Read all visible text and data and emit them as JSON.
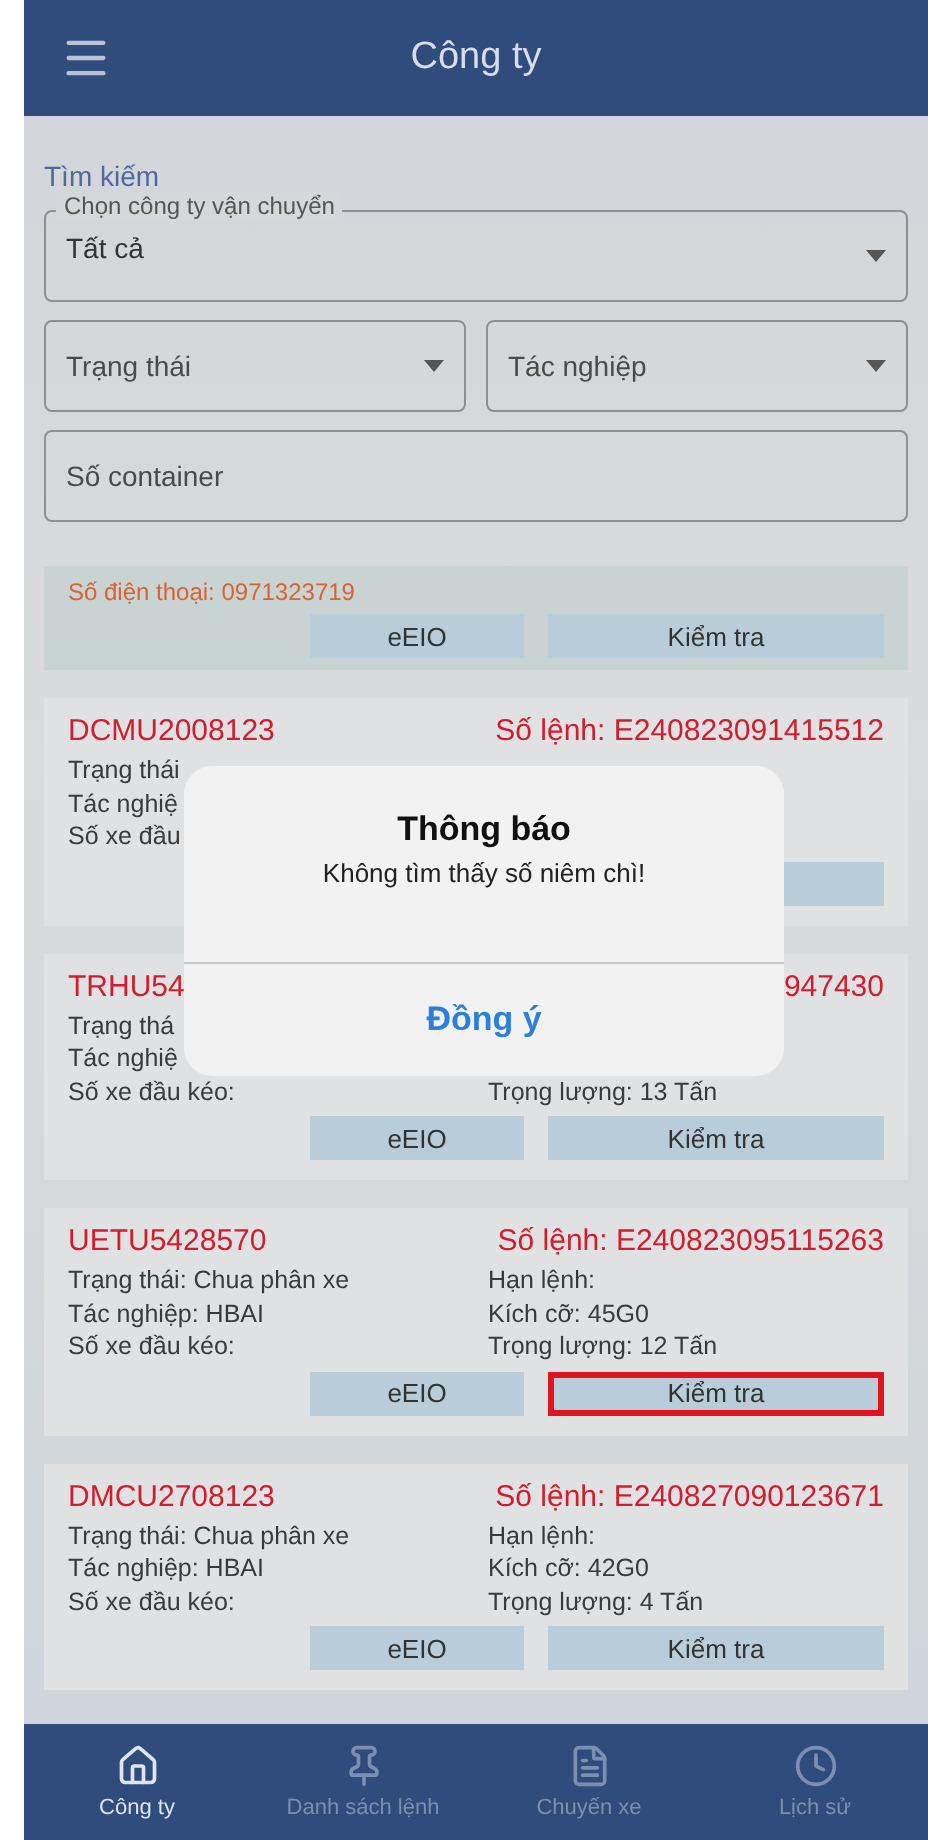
{
  "header": {
    "title": "Công ty"
  },
  "search": {
    "heading": "Tìm kiếm",
    "company_select": {
      "label": "Chọn công ty vận chuyển",
      "value": "Tất cả"
    },
    "status_select": {
      "placeholder": "Trạng thái"
    },
    "operation_select": {
      "placeholder": "Tác nghiệp"
    },
    "container_field": {
      "placeholder": "Số container"
    }
  },
  "cards": [
    {
      "kind": "phone",
      "phone": "Số điện thoại: 0971323719",
      "buttons": [
        {
          "label": "eEIO",
          "highlighted": false
        },
        {
          "label": "Kiểm tra",
          "highlighted": false
        }
      ]
    },
    {
      "kind": "order",
      "container": "DCMU2008123",
      "order_no": "Số lệnh: E240823091415512",
      "rows": [
        {
          "left": "Trạng thái"
        },
        {
          "left": "Tác nghiệ"
        },
        {
          "left": "Số xe đầu"
        }
      ],
      "buttons": [
        {
          "highlighted": false
        }
      ]
    },
    {
      "kind": "order",
      "container": "TRHU54",
      "order_no": "947430",
      "rows": [
        {
          "left": "Trạng thá"
        },
        {
          "left": "Tác nghiệ"
        },
        {
          "left": "Số xe đầu kéo:",
          "right": "Trọng lượng: 13 Tấn"
        }
      ],
      "buttons": [
        {
          "label": "eEIO",
          "highlighted": false
        },
        {
          "label": "Kiểm tra",
          "highlighted": false
        }
      ]
    },
    {
      "kind": "order",
      "container": "UETU5428570",
      "order_no": "Số lệnh: E240823095115263",
      "rows": [
        {
          "left": "Trạng thái: Chua phân xe",
          "right": "Hạn lệnh:"
        },
        {
          "left": "Tác nghiệp: HBAI",
          "right": "Kích cỡ: 45G0"
        },
        {
          "left": "Số xe đầu kéo:",
          "right": "Trọng lượng: 12 Tấn"
        }
      ],
      "buttons": [
        {
          "label": "eEIO",
          "highlighted": false
        },
        {
          "label": "Kiểm tra",
          "highlighted": true
        }
      ]
    },
    {
      "kind": "order",
      "container": "DMCU2708123",
      "order_no": "Số lệnh: E240827090123671",
      "rows": [
        {
          "left": "Trạng thái: Chua phân xe",
          "right": "Hạn lệnh:"
        },
        {
          "left": "Tác nghiệp: HBAI",
          "right": "Kích cỡ: 42G0"
        },
        {
          "left": "Số xe đầu kéo:",
          "right": "Trọng lượng: 4 Tấn"
        }
      ],
      "buttons": [
        {
          "label": "eEIO",
          "highlighted": false
        },
        {
          "label": "Kiểm tra",
          "highlighted": false
        }
      ]
    }
  ],
  "dialog": {
    "title": "Thông báo",
    "message": "Không tìm thấy số niêm chì!",
    "button": "Đồng ý"
  },
  "nav": [
    {
      "label": "Công ty",
      "selected": true
    },
    {
      "label": "Danh sách lệnh",
      "selected": false
    },
    {
      "label": "Chuyến xe",
      "selected": false
    },
    {
      "label": "Lịch sử",
      "selected": false
    }
  ]
}
